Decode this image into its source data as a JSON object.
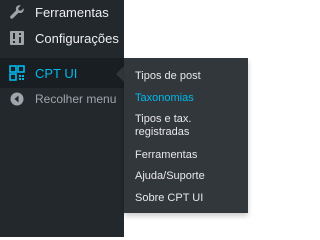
{
  "sidebar": {
    "items": [
      {
        "label": "Ferramentas",
        "icon": "wrench-icon"
      },
      {
        "label": "Configurações",
        "icon": "settings-sliders-icon"
      },
      {
        "label": "CPT UI",
        "icon": "grid-icon",
        "current": true
      },
      {
        "label": "Recolher menu",
        "icon": "collapse-icon"
      }
    ]
  },
  "flyout": {
    "items": [
      {
        "label": "Tipos de post"
      },
      {
        "label": "Taxonomias",
        "active": true
      },
      {
        "label": "Tipos e tax. registradas"
      },
      {
        "label": "Ferramentas"
      },
      {
        "label": "Ajuda/Suporte"
      },
      {
        "label": "Sobre CPT UI"
      }
    ]
  },
  "colors": {
    "sidebar_bg": "#23282d",
    "flyout_bg": "#32373c",
    "accent": "#00b9eb",
    "text": "#eeeeee",
    "muted": "#a0a5aa"
  }
}
